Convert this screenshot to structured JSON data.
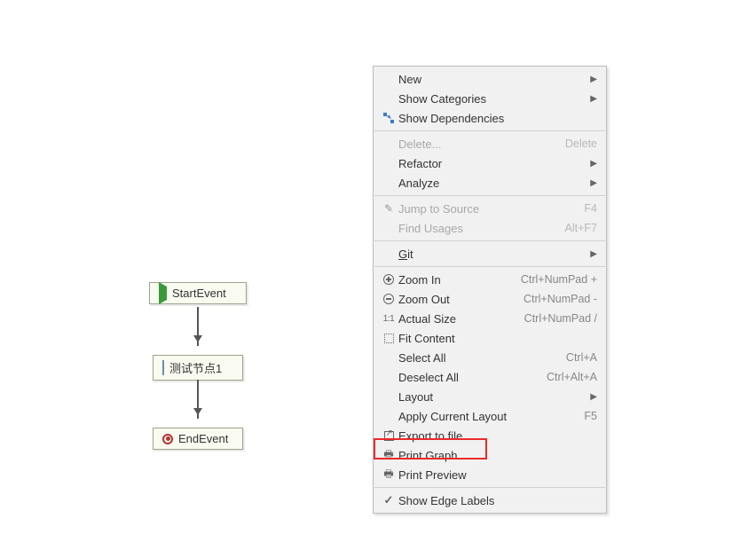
{
  "diagram": {
    "nodes": {
      "start": {
        "label": "StartEvent"
      },
      "mid": {
        "label": "测试节点1"
      },
      "end": {
        "label": "EndEvent"
      }
    }
  },
  "menu": {
    "new": {
      "label": "New"
    },
    "show_categories": {
      "label": "Show Categories"
    },
    "show_dependencies": {
      "label": "Show Dependencies"
    },
    "delete": {
      "label": "Delete...",
      "shortcut": "Delete"
    },
    "refactor": {
      "label": "Refactor"
    },
    "analyze": {
      "label": "Analyze"
    },
    "jump_to_source": {
      "label": "Jump to Source",
      "shortcut": "F4"
    },
    "find_usages": {
      "label": "Find Usages",
      "shortcut": "Alt+F7"
    },
    "git": {
      "label_prefix": "G",
      "label_rest": "it"
    },
    "zoom_in": {
      "label": "Zoom In",
      "shortcut": "Ctrl+NumPad +"
    },
    "zoom_out": {
      "label": "Zoom Out",
      "shortcut": "Ctrl+NumPad -"
    },
    "actual_size": {
      "label": "Actual Size",
      "shortcut": "Ctrl+NumPad /"
    },
    "fit_content": {
      "label": "Fit Content"
    },
    "select_all": {
      "label": "Select All",
      "shortcut": "Ctrl+A"
    },
    "deselect_all": {
      "label": "Deselect All",
      "shortcut": "Ctrl+Alt+A"
    },
    "layout": {
      "label": "Layout"
    },
    "apply_layout": {
      "label": "Apply Current Layout",
      "shortcut": "F5"
    },
    "export_to_file": {
      "label": "Export to file"
    },
    "print_graph": {
      "label": "Print Graph"
    },
    "print_preview": {
      "label": "Print Preview"
    },
    "show_edge_labels": {
      "label": "Show Edge Labels"
    }
  }
}
